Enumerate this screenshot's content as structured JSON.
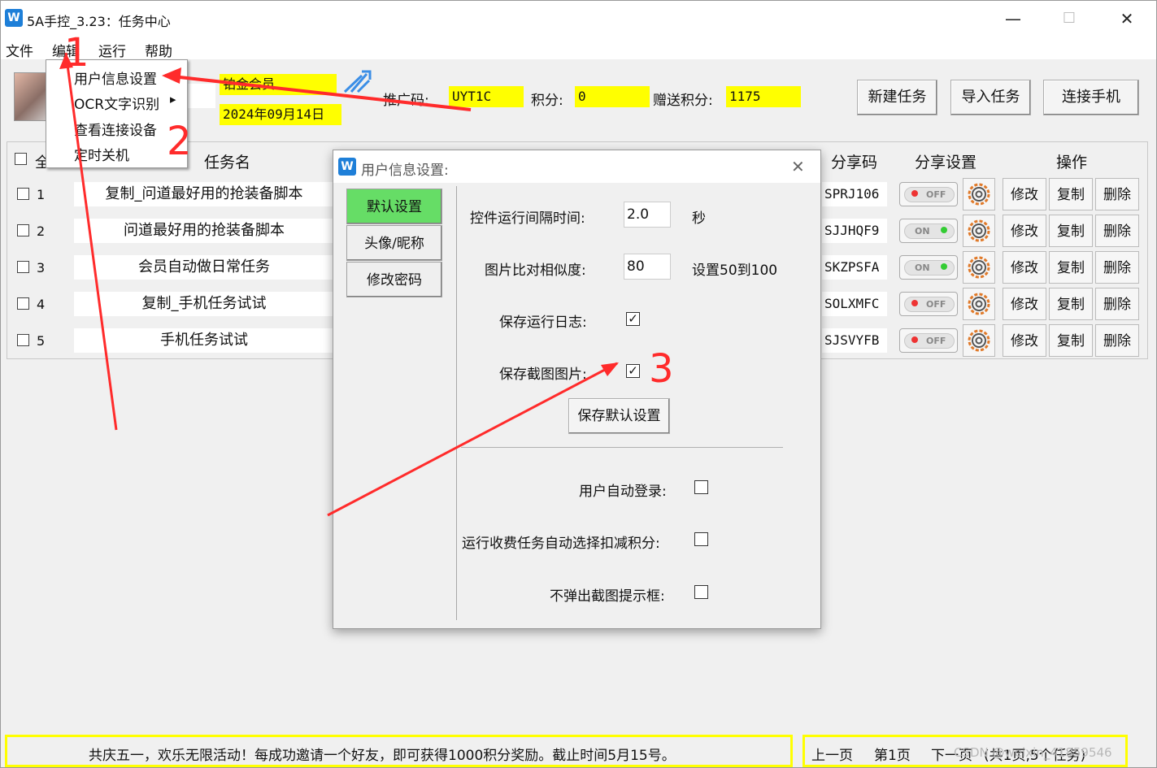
{
  "window": {
    "title": "5A手控_3.23：任务中心",
    "icon": "app-logo-icon",
    "controls": {
      "minimize": "—",
      "maximize": "☐",
      "close": "✕"
    }
  },
  "menubar": {
    "items": [
      "文件",
      "编辑",
      "运行",
      "帮助"
    ]
  },
  "edit_menu": {
    "items": [
      "用户信息设置",
      "OCR文字识别",
      "查看连接设备",
      "定时关机"
    ],
    "submenu_arrow": "▸"
  },
  "user_info": {
    "member_level": "铂金会员",
    "date": "2024年09月14日",
    "promo_label": "推广码:",
    "promo_code": "UYT1C",
    "points_label": "积分:",
    "points": "0",
    "gift_points_label": "赠送积分:",
    "gift_points": "1175"
  },
  "toolbar": {
    "new_task": "新建任务",
    "import_task": "导入任务",
    "connect_phone": "连接手机"
  },
  "table": {
    "headers": {
      "select_all": "全",
      "task_name": "任务名",
      "share_code": "分享码",
      "share_settings": "分享设置",
      "operations": "操作"
    },
    "rows": [
      {
        "num": "1",
        "name": "复制_问道最好用的抢装备脚本",
        "code": "SPRJ106",
        "toggle": "OFF"
      },
      {
        "num": "2",
        "name": "问道最好用的抢装备脚本",
        "code": "SJJHQF9",
        "toggle": "ON"
      },
      {
        "num": "3",
        "name": "会员自动做日常任务",
        "code": "SKZPSFA",
        "toggle": "ON"
      },
      {
        "num": "4",
        "name": "复制_手机任务试试",
        "code": "SOLXMFC",
        "toggle": "OFF"
      },
      {
        "num": "5",
        "name": "手机任务试试",
        "code": "SJSVYFB",
        "toggle": "OFF"
      }
    ],
    "op_labels": {
      "edit": "修改",
      "copy": "复制",
      "delete": "删除"
    }
  },
  "dialog": {
    "title": "用户信息设置:",
    "close": "✕",
    "tabs": [
      "默认设置",
      "头像/昵称",
      "修改密码"
    ],
    "interval_label": "控件运行间隔时间:",
    "interval_value": "2.0",
    "interval_unit": "秒",
    "similarity_label": "图片比对相似度:",
    "similarity_value": "80",
    "similarity_hint": "设置50到100",
    "save_log_label": "保存运行日志:",
    "save_log_checked": true,
    "save_screenshot_label": "保存截图图片:",
    "save_screenshot_checked": true,
    "save_button": "保存默认设置",
    "auto_login_label": "用户自动登录:",
    "auto_deduct_label": "运行收费任务自动选择扣减积分:",
    "no_popup_label": "不弹出截图提示框:",
    "check_mark": "✓"
  },
  "statusbar": {
    "announcement": "共庆五一，欢乐无限活动！每成功邀请一个好友，即可获得1000积分奖励。截止时间5月15号。",
    "prev_page": "上一页",
    "current_page": "第1页",
    "next_page": "下一页",
    "summary": "(共1页,5个任务)"
  },
  "watermark": "CSDN @weixin_41859546",
  "annotations": [
    "1",
    "2",
    "3"
  ],
  "colors": {
    "highlight_yellow": "#ffff00",
    "active_tab_green": "#66dd66",
    "arrow_red": "#ff2b2b",
    "title_blue": "#1e7fd8"
  }
}
